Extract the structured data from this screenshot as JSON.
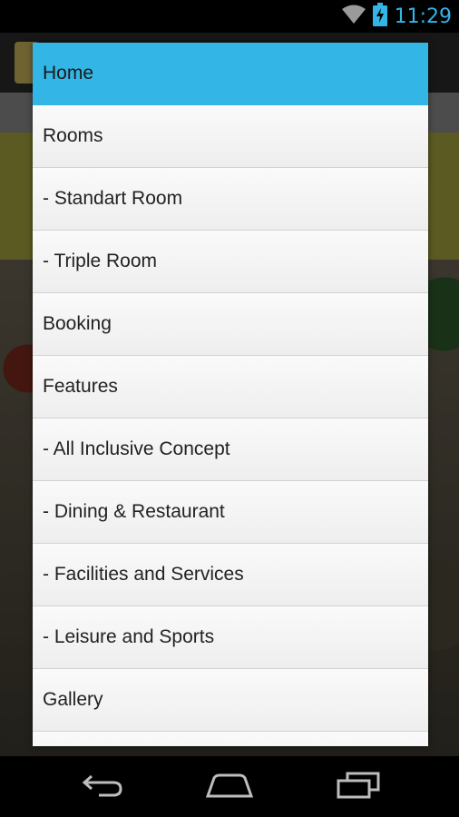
{
  "status_bar": {
    "time": "11:29",
    "icons": [
      "wifi-icon",
      "battery-charging-icon"
    ]
  },
  "menu": {
    "items": [
      {
        "label": "Home",
        "active": true
      },
      {
        "label": "Rooms"
      },
      {
        "label": "- Standart Room"
      },
      {
        "label": "- Triple Room"
      },
      {
        "label": "Booking"
      },
      {
        "label": "Features"
      },
      {
        "label": "- All Inclusive Concept"
      },
      {
        "label": "- Dining & Restaurant"
      },
      {
        "label": "- Facilities and Services"
      },
      {
        "label": "- Leisure and Sports"
      },
      {
        "label": "Gallery"
      },
      {
        "label": ""
      }
    ]
  },
  "nav_bar": {
    "buttons": [
      "back-icon",
      "home-icon",
      "recent-apps-icon"
    ]
  },
  "colors": {
    "accent": "#33b5e5",
    "menu_bg": "#f2f2f2"
  }
}
